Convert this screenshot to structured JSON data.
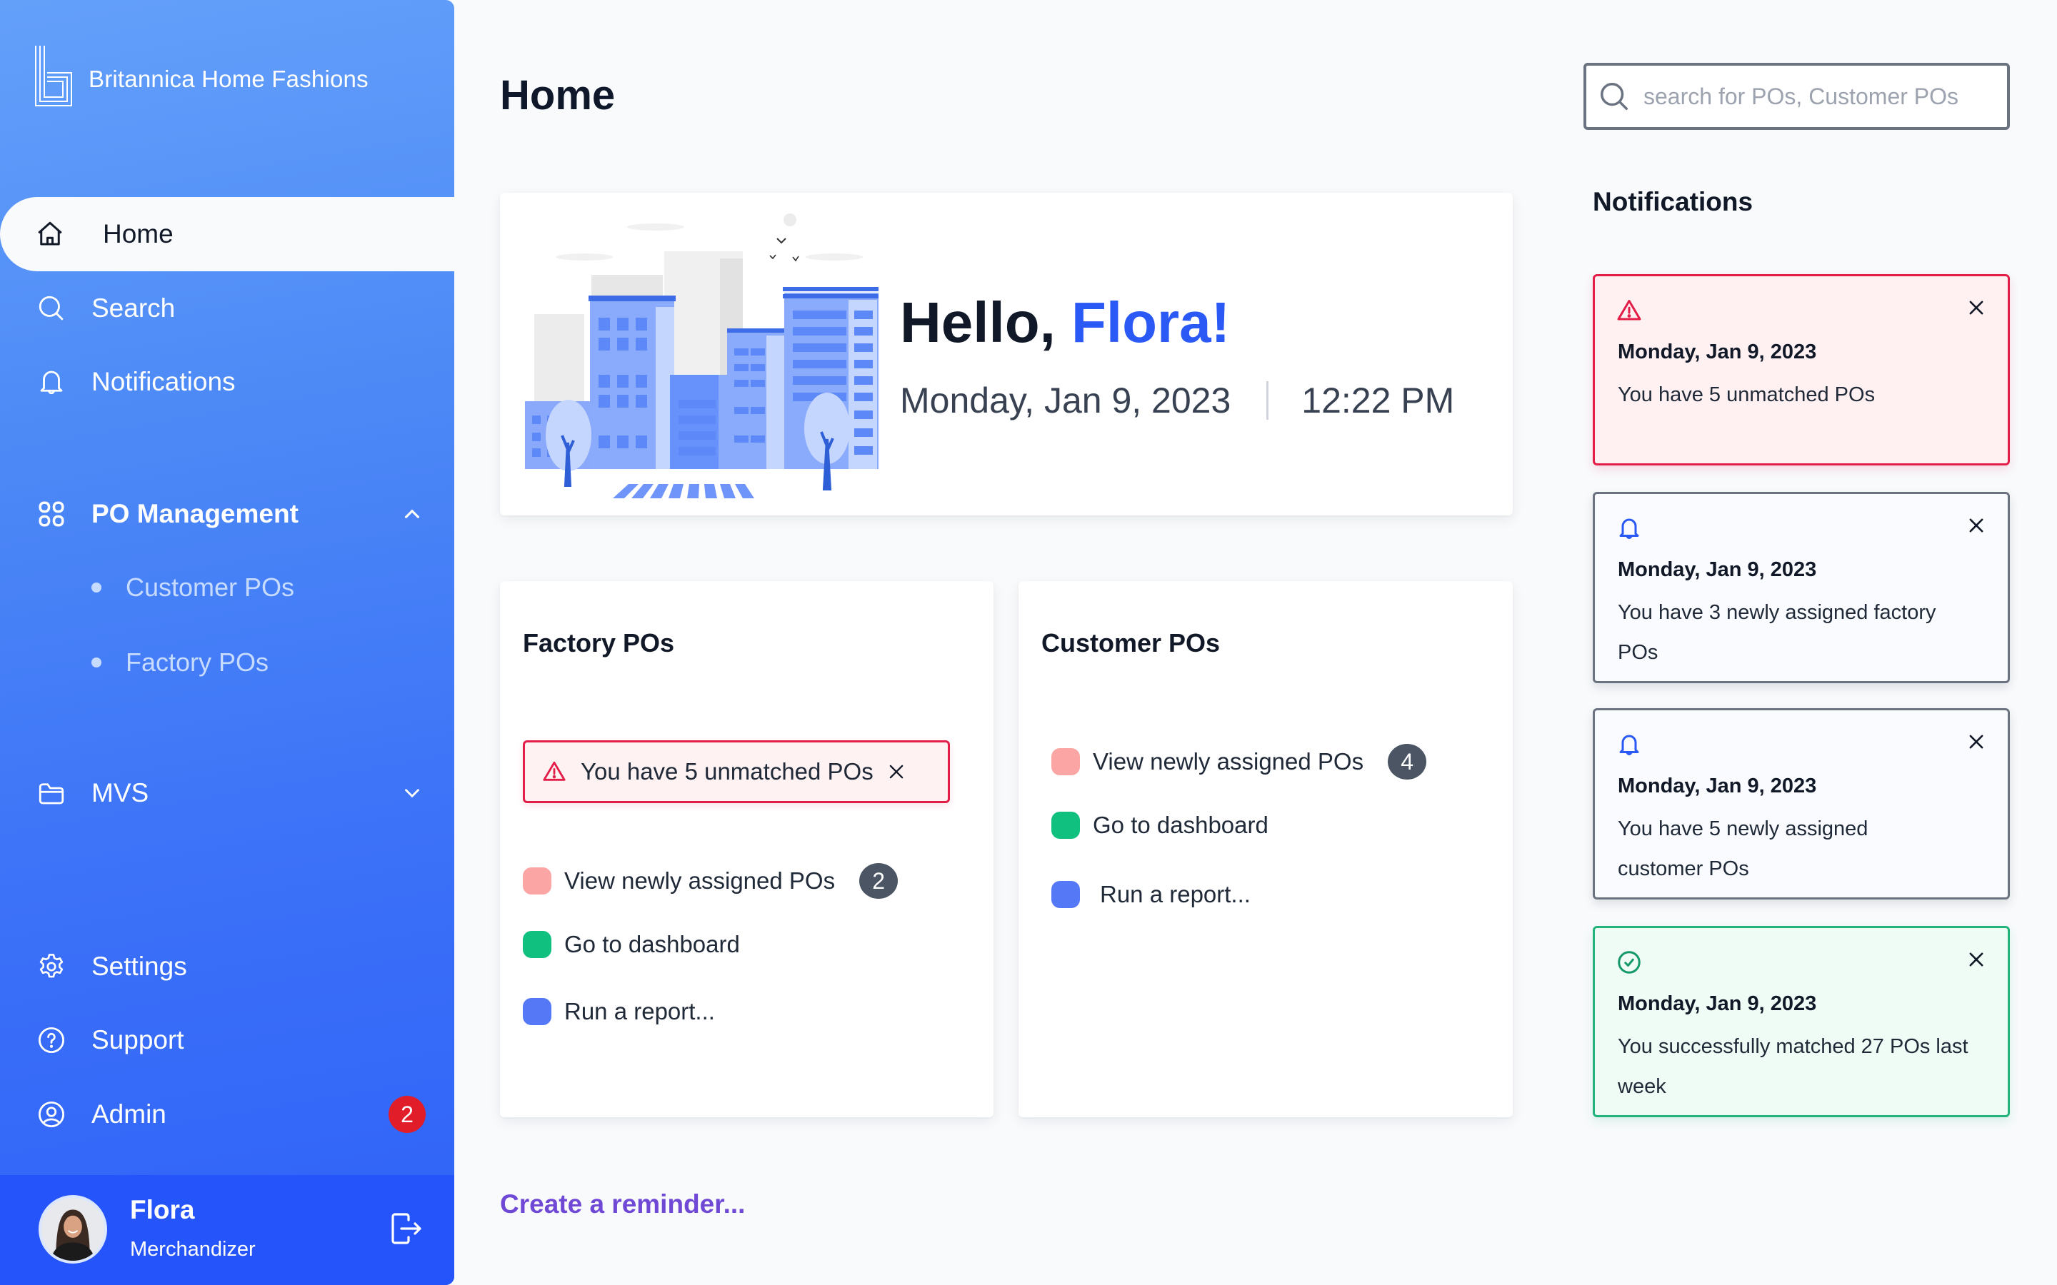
{
  "brand": {
    "name": "Britannica Home Fashions"
  },
  "sidebar": {
    "items": [
      {
        "label": "Home",
        "icon": "home-icon",
        "active": true
      },
      {
        "label": "Search",
        "icon": "search-icon"
      },
      {
        "label": "Notifications",
        "icon": "bell-icon"
      },
      {
        "label": "PO Management",
        "icon": "grid-icon",
        "expanded": true,
        "children": [
          {
            "label": "Customer POs"
          },
          {
            "label": "Factory POs"
          }
        ]
      },
      {
        "label": "MVS",
        "icon": "folder-icon",
        "expanded": false
      },
      {
        "label": "Settings",
        "icon": "gear-icon"
      },
      {
        "label": "Support",
        "icon": "help-circle-icon"
      },
      {
        "label": "Admin",
        "icon": "user-circle-icon",
        "badge": "2"
      }
    ]
  },
  "user": {
    "name": "Flora",
    "role": "Merchandizer"
  },
  "page": {
    "title": "Home"
  },
  "hero": {
    "greeting": "Hello,",
    "name": "Flora!",
    "date": "Monday, Jan 9, 2023",
    "time": "12:22 PM"
  },
  "factory": {
    "title": "Factory POs",
    "alert": "You have 5 unmatched POs",
    "actions": [
      {
        "label": "View newly assigned POs",
        "count": "2",
        "color": "#fca5a5"
      },
      {
        "label": "Go to dashboard",
        "color": "#10c07f"
      },
      {
        "label": "Run a report...",
        "color": "#5578f7"
      }
    ]
  },
  "customer": {
    "title": "Customer POs",
    "actions": [
      {
        "label": "View newly assigned POs",
        "count": "4",
        "color": "#fca5a5"
      },
      {
        "label": "Go to dashboard",
        "color": "#10c07f"
      },
      {
        "label": "Run a report...",
        "color": "#5578f7"
      }
    ]
  },
  "reminder": {
    "label": "Create a reminder..."
  },
  "search": {
    "placeholder": "search for POs, Customer POs",
    "value": ""
  },
  "notifications": {
    "title": "Notifications",
    "items": [
      {
        "type": "error",
        "icon": "warning-icon",
        "date": "Monday, Jan 9, 2023",
        "message": "You have 5 unmatched POs"
      },
      {
        "type": "info",
        "icon": "bell-icon",
        "date": "Monday, Jan 9, 2023",
        "message": "You have 3 newly assigned factory POs"
      },
      {
        "type": "info",
        "icon": "bell-icon",
        "date": "Monday, Jan 9, 2023",
        "message": "You have 5 newly assigned customer POs"
      },
      {
        "type": "success",
        "icon": "check-circle-icon",
        "date": "Monday, Jan 9, 2023",
        "message": "You successfully matched 27 POs last week"
      }
    ]
  },
  "colors": {
    "accent": "#2a59f5",
    "error": "#e11d48",
    "success": "#22b47a",
    "reminder": "#7048d6",
    "badge": "#e11d2a"
  }
}
